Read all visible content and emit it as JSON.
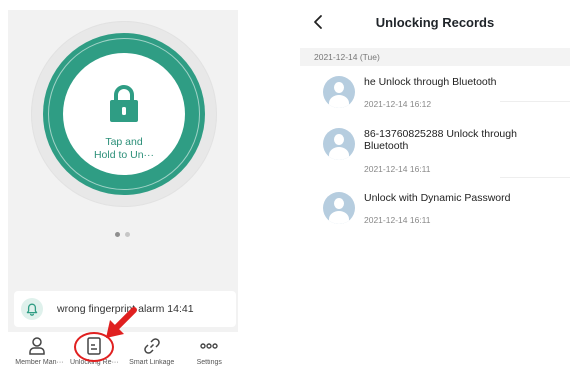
{
  "lock_screen": {
    "tap_text": "Tap and\nHold to Un···",
    "lock_icon": "padlock-icon",
    "page_dots": 2,
    "alarm": {
      "icon": "bell-icon",
      "text": "wrong fingerprint alarm 14:41"
    },
    "tabs": [
      {
        "icon": "person-icon",
        "label": "Member Man···"
      },
      {
        "icon": "document-icon",
        "label": "Unlocking Re···"
      },
      {
        "icon": "link-icon",
        "label": "Smart Linkage"
      },
      {
        "icon": "more-icon",
        "label": "Settings"
      }
    ],
    "accent_color": "#2f9d84",
    "highlight_color": "#e02020"
  },
  "records_screen": {
    "title": "Unlocking Records",
    "back_icon": "chevron-left-icon",
    "date_header": "2021-12-14 (Tue)",
    "records": [
      {
        "message": "he Unlock through Bluetooth",
        "time": "2021-12-14 16:12"
      },
      {
        "message": "86-13760825288 Unlock through Bluetooth",
        "time": "2021-12-14 16:11"
      },
      {
        "message": "Unlock with Dynamic Password",
        "time": "2021-12-14 16:11"
      }
    ]
  }
}
